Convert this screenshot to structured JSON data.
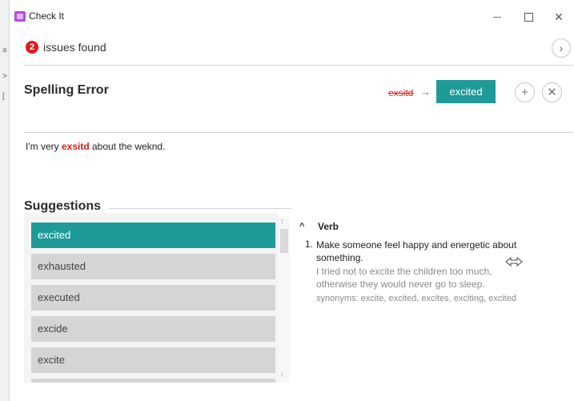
{
  "window": {
    "title": "Check It",
    "minimize_icon": "minimize-icon",
    "maximize_icon": "maximize-icon",
    "close_glyph": "✕"
  },
  "issues": {
    "count": "2",
    "label": "issues found",
    "next_glyph": "›"
  },
  "error": {
    "heading": "Spelling Error",
    "misspelled": "exsitd",
    "arrow": "→",
    "correction": "excited",
    "add_glyph": "+",
    "dismiss_glyph": "✕"
  },
  "sentence": {
    "before": "I'm very ",
    "misspelled": "exsitd",
    "after": " about the weknd."
  },
  "suggestions": {
    "heading": "Suggestions",
    "items": [
      "excited",
      "exhausted",
      "executed",
      "excide",
      "excite"
    ],
    "selected_index": 0,
    "scroll_up_glyph": "↑",
    "scroll_down_glyph": "↓"
  },
  "definition": {
    "chevron": "^",
    "part_of_speech": "Verb",
    "number": "1.",
    "meaning": "Make someone feel happy and energetic about something.",
    "example": "I tried not to excite the children too much, otherwise they would never go to sleep.",
    "synonyms": "synonyms: excite, excited, excites, exciting, excited"
  },
  "colors": {
    "accent": "#1f9a99",
    "error": "#e01b1b",
    "list_item": "#d5d5d5"
  }
}
